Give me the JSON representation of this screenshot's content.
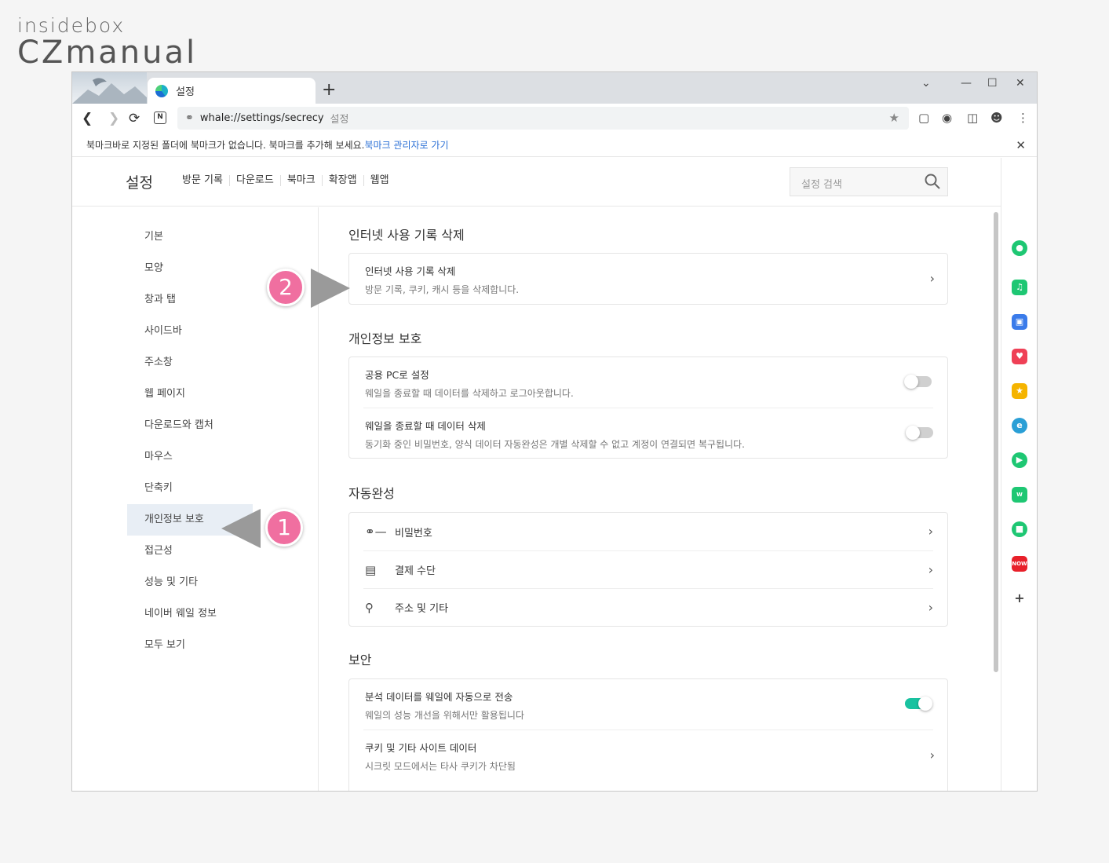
{
  "logo": {
    "line1": "insidebox",
    "line2": "CZmanual"
  },
  "tab": {
    "title": "설정",
    "new_tab": "+"
  },
  "window_controls": {
    "dropdown": "⌄",
    "minimize": "—",
    "maximize": "☐",
    "close": "✕"
  },
  "address": {
    "url": "whale://settings/secrecy",
    "page_title": "설정"
  },
  "bookmark_bar": {
    "message": "북마크바로 지정된 폴더에 북마크가 없습니다. 북마크를 추가해 보세요.",
    "link": "북마크 관리자로 가기",
    "close": "✕"
  },
  "header": {
    "title": "설정",
    "nav": [
      "방문 기록",
      "다운로드",
      "북마크",
      "확장앱",
      "웹앱"
    ],
    "search_placeholder": "설정 검색"
  },
  "leftnav": {
    "items": [
      "기본",
      "모양",
      "창과 탭",
      "사이드바",
      "주소창",
      "웹 페이지",
      "다운로드와 캡처",
      "마우스",
      "단축키",
      "개인정보 보호",
      "접근성",
      "성능 및 기타",
      "네이버 웨일 정보",
      "모두 보기"
    ],
    "active_index": 9
  },
  "sections": {
    "history": {
      "title": "인터넷 사용 기록 삭제",
      "row_title": "인터넷 사용 기록 삭제",
      "row_desc": "방문 기록, 쿠키, 캐시 등을 삭제합니다."
    },
    "privacy": {
      "title": "개인정보 보호",
      "rows": [
        {
          "title": "공용 PC로 설정",
          "desc": "웨일을 종료할 때 데이터를 삭제하고 로그아웃합니다.",
          "toggle": false
        },
        {
          "title": "웨일을 종료할 때 데이터 삭제",
          "desc": "동기화 중인 비밀번호, 양식 데이터 자동완성은 개별 삭제할 수 없고 계정이 연결되면 복구됩니다.",
          "toggle": false
        }
      ]
    },
    "autofill": {
      "title": "자동완성",
      "rows": [
        {
          "icon": "key-icon",
          "label": "비밀번호"
        },
        {
          "icon": "credit-card-icon",
          "label": "결제 수단"
        },
        {
          "icon": "location-pin-icon",
          "label": "주소 및 기타"
        }
      ]
    },
    "security": {
      "title": "보안",
      "rows": [
        {
          "title": "분석 데이터를 웨일에 자동으로 전송",
          "desc": "웨일의 성능 개선을 위해서만 활용됩니다",
          "toggle": true
        },
        {
          "title": "쿠키 및 기타 사이트 데이터",
          "desc": "시크릿 모드에서는 타사 쿠키가 차단됨"
        }
      ]
    }
  },
  "sidebar_apps": [
    {
      "icon": "green-circle-app-icon",
      "color": "#1ec773"
    },
    {
      "icon": "bell-app-icon",
      "color": "#1ec773"
    },
    {
      "icon": "briefcase-app-icon",
      "color": "#3a7bea"
    },
    {
      "icon": "pocket-app-icon",
      "color": "#ef4056"
    },
    {
      "icon": "star-app-icon",
      "color": "#f5b400"
    },
    {
      "icon": "translate-app-icon",
      "color": "#2a9fd6"
    },
    {
      "icon": "play-app-icon",
      "color": "#1ec773"
    },
    {
      "icon": "webtoon-app-icon",
      "color": "#1ec773"
    },
    {
      "icon": "square-app-icon",
      "color": "#1ec773"
    },
    {
      "icon": "now-app-icon",
      "color": "#e8202a"
    }
  ],
  "annotations": {
    "badge1": "1",
    "badge2": "2",
    "color": "#f06fa0"
  }
}
